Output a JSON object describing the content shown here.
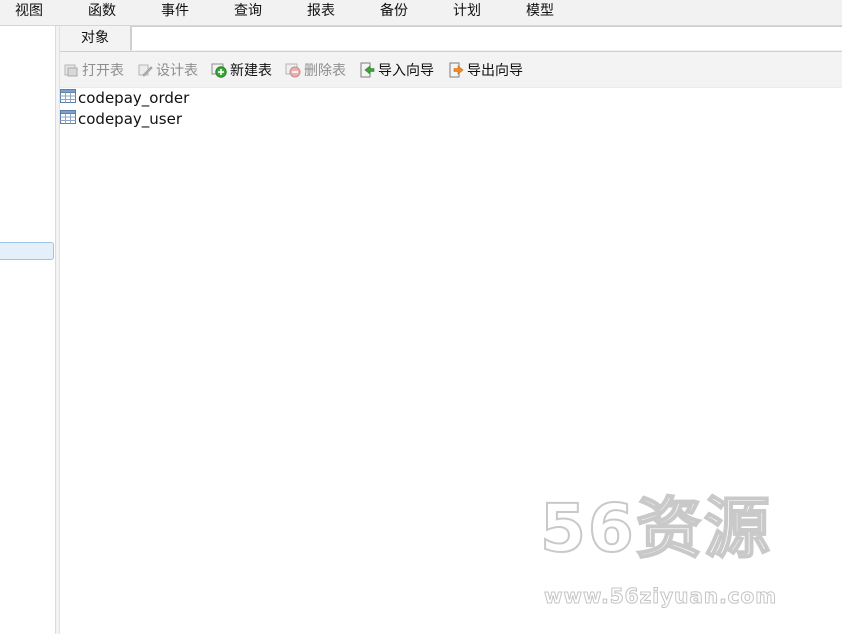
{
  "menu": {
    "items": [
      {
        "label": "视图"
      },
      {
        "label": "函数"
      },
      {
        "label": "事件"
      },
      {
        "label": "查询"
      },
      {
        "label": "报表"
      },
      {
        "label": "备份"
      },
      {
        "label": "计划"
      },
      {
        "label": "模型"
      }
    ]
  },
  "tabs": {
    "objects_label": "对象"
  },
  "toolbar": {
    "open_table": "打开表",
    "design_table": "设计表",
    "new_table": "新建表",
    "delete_table": "删除表",
    "import_wizard": "导入向导",
    "export_wizard": "导出向导"
  },
  "objects": [
    {
      "name": "codepay_order",
      "icon": "table-icon"
    },
    {
      "name": "codepay_user",
      "icon": "table-icon"
    }
  ],
  "watermark": {
    "logo_text": "56资源",
    "url_text": "www.56ziyuan.com"
  },
  "colors": {
    "menubar_bg": "#f2f2f2",
    "toolbar_bg": "#f3f3f3",
    "selection_bg": "#e4effa",
    "selection_border": "#9cc2e8",
    "new_icon_green": "#3aa635",
    "delete_icon_red": "#d9534f"
  }
}
